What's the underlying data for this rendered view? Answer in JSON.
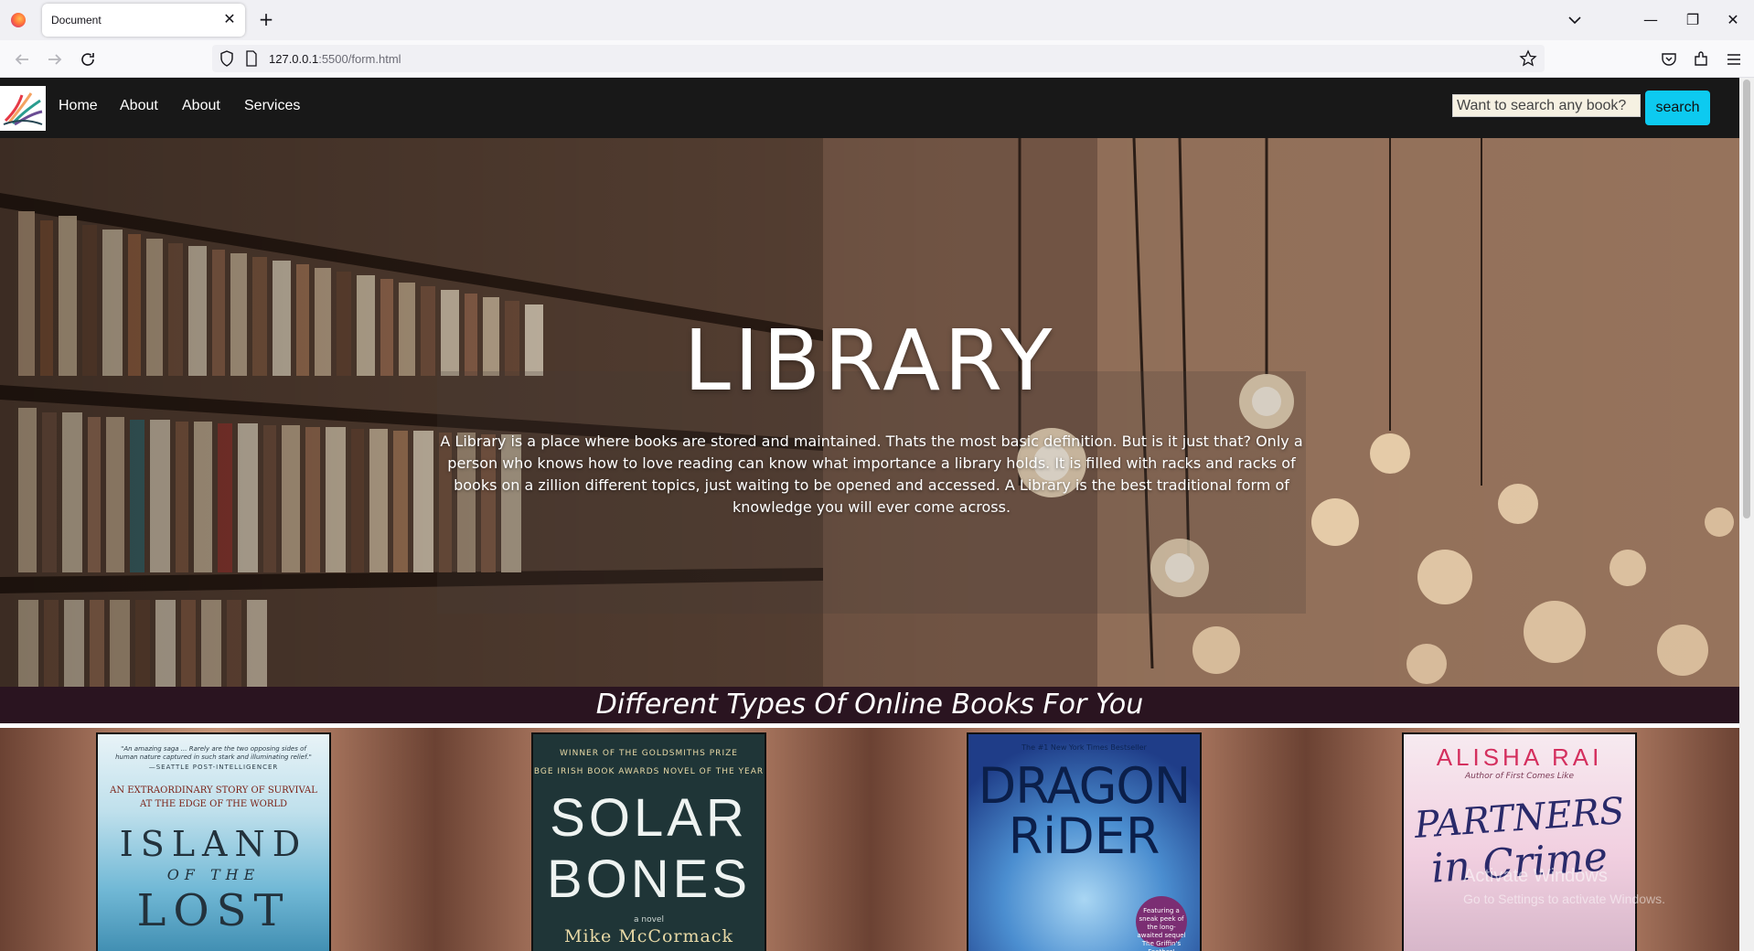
{
  "browser": {
    "tab_title": "Document",
    "tab_close": "✕",
    "new_tab": "+",
    "url_host": "127.0.0.1",
    "url_rest": ":5500/form.html",
    "window_min": "—",
    "window_restore": "❐",
    "window_close": "✕"
  },
  "nav": {
    "links": [
      "Home",
      "About",
      "About",
      "Services"
    ],
    "search_placeholder": "Want to search any book?",
    "search_button": "search"
  },
  "hero": {
    "title": "LIBRARY",
    "text": "A Library is a place where books are stored and maintained. Thats the most basic definition. But is it just that? Only a person who knows how to love reading can know what importance a library holds. It is filled with racks and racks of books on a zillion different topics, just waiting to be opened and accessed. A Library is the best traditional form of knowledge you will ever come across."
  },
  "section": {
    "title": "Different Types Of Online Books For You"
  },
  "books": [
    {
      "quote": "\"An amazing saga ... Rarely are the two opposing sides of human nature captured in such stark and illuminating relief.\"",
      "quote_src": "—SEATTLE POST-INTELLIGENCER",
      "tagline1": "AN EXTRAORDINARY STORY OF SURVIVAL",
      "tagline2": "AT THE EDGE OF THE WORLD",
      "title1": "ISLAND",
      "title2": "OF THE",
      "title3": "LOST"
    },
    {
      "award1": "WINNER OF THE GOLDSMITHS PRIZE",
      "award2": "BGE IRISH BOOK AWARDS NOVEL OF THE YEAR",
      "title1": "SOLAR",
      "title2": "BONES",
      "sub": "a novel",
      "author": "Mike McCormack"
    },
    {
      "banner": "The #1 New York Times Bestseller",
      "title1": "DRAGON",
      "title2": "RiDER",
      "badge": "Featuring a sneak peek of the long-awaited sequel The Griffin's Feather!"
    },
    {
      "author": "ALISHA RAI",
      "byline": "Author of First Comes Like",
      "title1": "PARTNERS",
      "title2": "in Crime"
    }
  ],
  "os": {
    "watermark_title": "Activate Windows",
    "watermark_sub": "Go to Settings to activate Windows."
  },
  "colors": {
    "nav_bg": "#181818",
    "search_button": "#0dcaf0",
    "band_bg": "#2a1420"
  }
}
